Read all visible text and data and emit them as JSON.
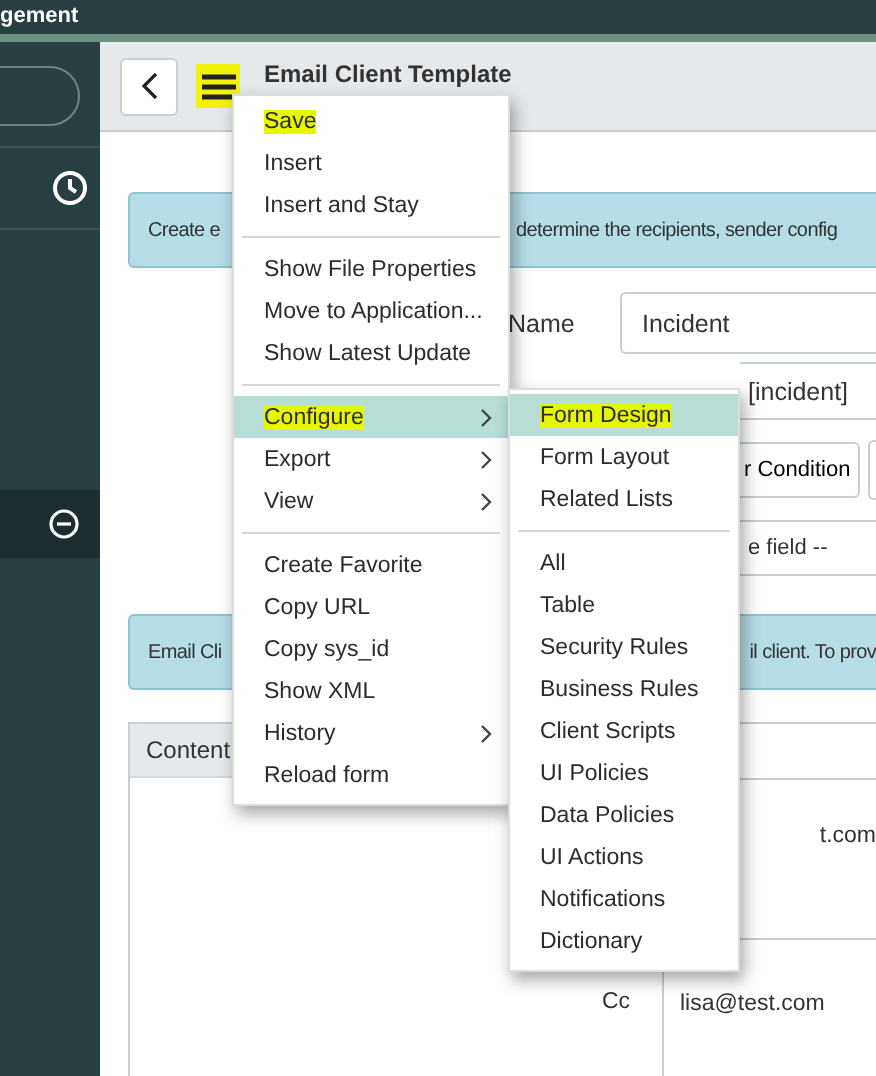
{
  "top_bar": {
    "title": "gement"
  },
  "header": {
    "title": "Email Client Template",
    "menu_marked": true
  },
  "banner_1": {
    "left": "Create e",
    "right": "determine the recipients, sender config"
  },
  "form": {
    "name_label": "Name",
    "name_value": "Incident",
    "table_value": "[incident]",
    "condition_button": "r Condition",
    "field_select": "e field --"
  },
  "banner_2": {
    "left": "Email Cli",
    "right": "il client. To prov"
  },
  "content_tab": "Content",
  "recipients": [
    {
      "value": "t.com"
    },
    {
      "label": "Cc",
      "value": "lisa@test.com"
    }
  ],
  "context_menu": {
    "groups": [
      [
        {
          "label": "Save",
          "submenu": false,
          "highlighted": false,
          "marked": true
        },
        {
          "label": "Insert",
          "submenu": false,
          "highlighted": false,
          "marked": false
        },
        {
          "label": "Insert and Stay",
          "submenu": false,
          "highlighted": false,
          "marked": false
        }
      ],
      [
        {
          "label": "Show File Properties",
          "submenu": false,
          "highlighted": false,
          "marked": false
        },
        {
          "label": "Move to Application...",
          "submenu": false,
          "highlighted": false,
          "marked": false
        },
        {
          "label": "Show Latest Update",
          "submenu": false,
          "highlighted": false,
          "marked": false
        }
      ],
      [
        {
          "label": "Configure",
          "submenu": true,
          "highlighted": true,
          "marked": true
        },
        {
          "label": "Export",
          "submenu": true,
          "highlighted": false,
          "marked": false
        },
        {
          "label": "View",
          "submenu": true,
          "highlighted": false,
          "marked": false
        }
      ],
      [
        {
          "label": "Create Favorite",
          "submenu": false,
          "highlighted": false,
          "marked": false
        },
        {
          "label": "Copy URL",
          "submenu": false,
          "highlighted": false,
          "marked": false
        },
        {
          "label": "Copy sys_id",
          "submenu": false,
          "highlighted": false,
          "marked": false
        },
        {
          "label": "Show XML",
          "submenu": false,
          "highlighted": false,
          "marked": false
        },
        {
          "label": "History",
          "submenu": true,
          "highlighted": false,
          "marked": false
        },
        {
          "label": "Reload form",
          "submenu": false,
          "highlighted": false,
          "marked": false
        }
      ]
    ]
  },
  "submenu": {
    "groups": [
      [
        {
          "label": "Form Design",
          "submenu": false,
          "highlighted": true,
          "marked": true
        },
        {
          "label": "Form Layout",
          "submenu": false,
          "highlighted": false,
          "marked": false
        },
        {
          "label": "Related Lists",
          "submenu": false,
          "highlighted": false,
          "marked": false
        }
      ],
      [
        {
          "label": "All",
          "submenu": false,
          "highlighted": false,
          "marked": false
        },
        {
          "label": "Table",
          "submenu": false,
          "highlighted": false,
          "marked": false
        },
        {
          "label": "Security Rules",
          "submenu": false,
          "highlighted": false,
          "marked": false
        },
        {
          "label": "Business Rules",
          "submenu": false,
          "highlighted": false,
          "marked": false
        },
        {
          "label": "Client Scripts",
          "submenu": false,
          "highlighted": false,
          "marked": false
        },
        {
          "label": "UI Policies",
          "submenu": false,
          "highlighted": false,
          "marked": false
        },
        {
          "label": "Data Policies",
          "submenu": false,
          "highlighted": false,
          "marked": false
        },
        {
          "label": "UI Actions",
          "submenu": false,
          "highlighted": false,
          "marked": false
        },
        {
          "label": "Notifications",
          "submenu": false,
          "highlighted": false,
          "marked": false
        },
        {
          "label": "Dictionary",
          "submenu": false,
          "highlighted": false,
          "marked": false
        }
      ]
    ]
  }
}
